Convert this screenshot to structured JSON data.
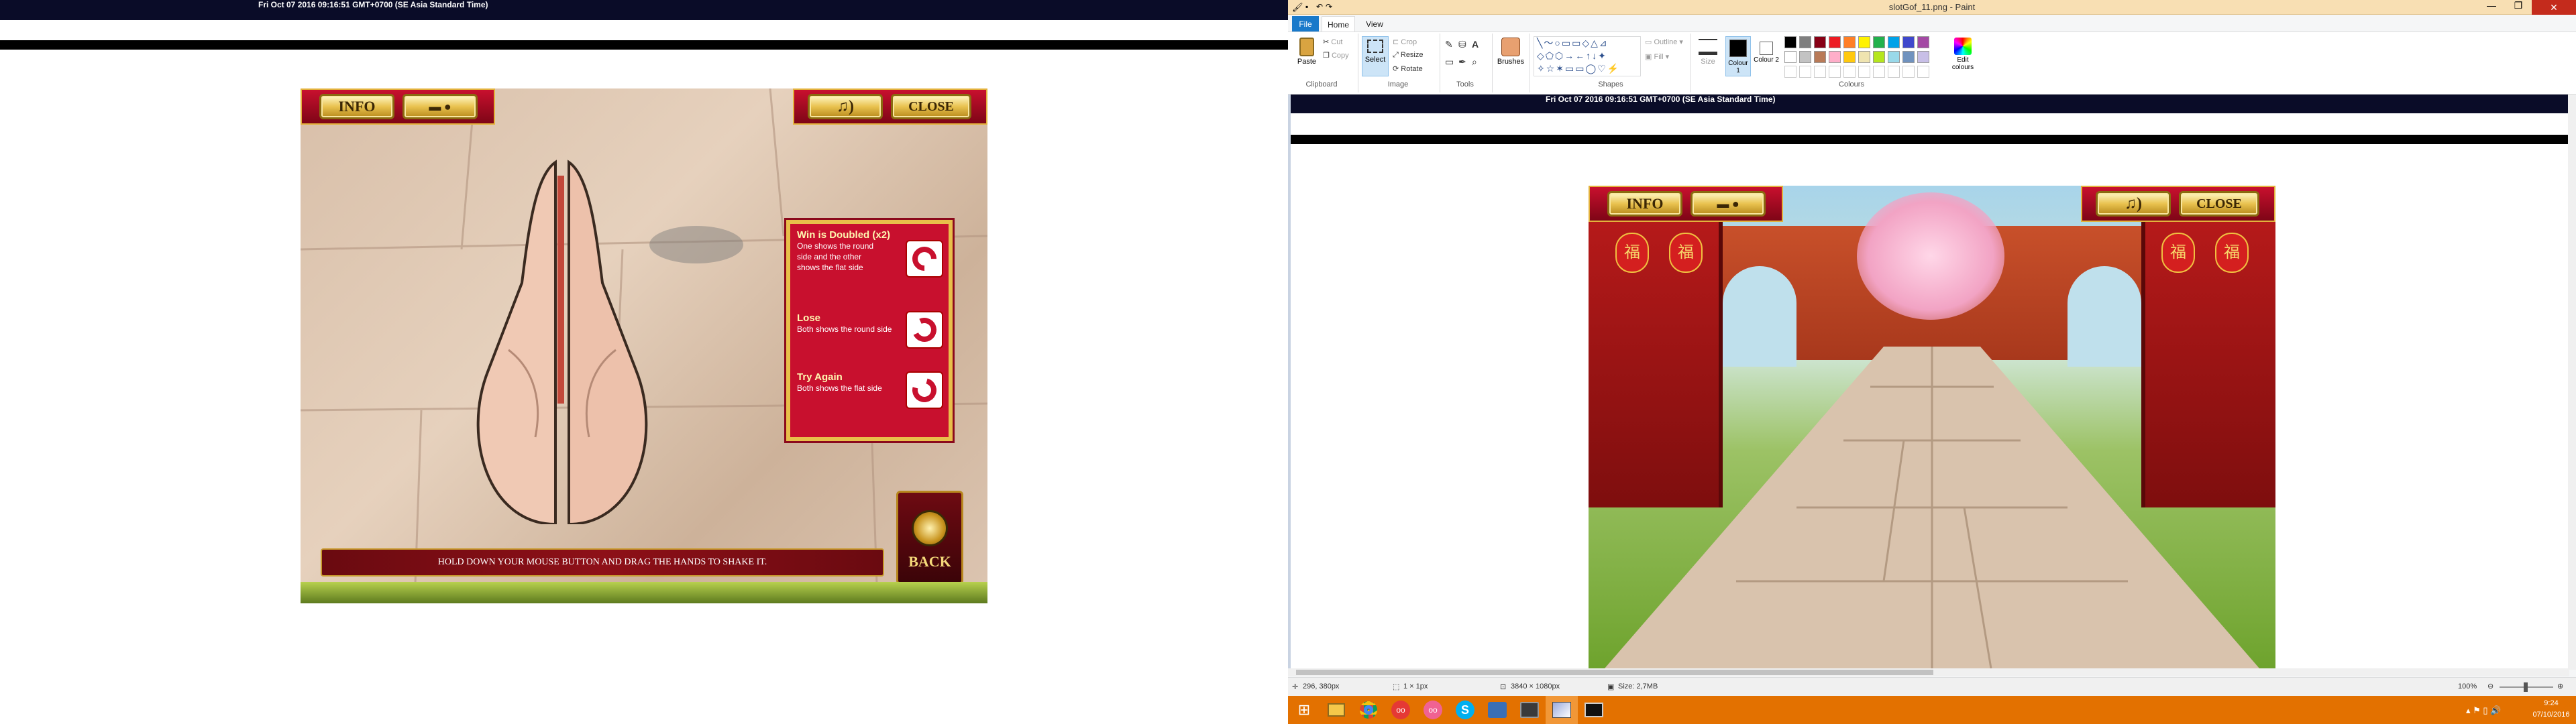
{
  "left_screen": {
    "timestamp": "Fri Oct 07 2016 09:16:51 GMT+0700 (SE Asia Standard Time)",
    "buttons": {
      "info": "INFO",
      "close": "CLOSE",
      "back": "BACK"
    },
    "panel": {
      "sections": [
        {
          "title": "Win is Doubled",
          "badge": "(x2)",
          "desc": "One shows the round side and the other shows the flat side"
        },
        {
          "title": "Lose",
          "badge": "",
          "desc": "Both shows the round side"
        },
        {
          "title": "Try Again",
          "badge": "",
          "desc": "Both shows the flat side"
        }
      ]
    },
    "hint": "HOLD DOWN YOUR MOUSE BUTTON AND DRAG THE HANDS TO SHAKE IT."
  },
  "paint": {
    "title": "slotGof_11.png - Paint",
    "tabs": [
      "File",
      "Home",
      "View"
    ],
    "clipboard": {
      "paste": "Paste",
      "cut": "Cut",
      "copy": "Copy",
      "label": "Clipboard"
    },
    "image": {
      "select": "Select",
      "crop": "Crop",
      "resize": "Resize",
      "rotate": "Rotate",
      "label": "Image"
    },
    "tools": {
      "label": "Tools"
    },
    "brushes": "Brushes",
    "shapes": {
      "outline": "Outline",
      "fill": "Fill",
      "label": "Shapes"
    },
    "size": "Size",
    "colour1": "Colour 1",
    "colour2": "Colour 2",
    "colours_label": "Colours",
    "edit_colours": "Edit colours",
    "palette": [
      "#000000",
      "#7f7f7f",
      "#880015",
      "#ed1c24",
      "#ff7f27",
      "#fff200",
      "#22b14c",
      "#00a2e8",
      "#3f48cc",
      "#a349a4",
      "#ffffff",
      "#c3c3c3",
      "#b97a57",
      "#ffaec9",
      "#ffc90e",
      "#efe4b0",
      "#b5e61d",
      "#99d9ea",
      "#7092be",
      "#c8bfe7"
    ],
    "canvas": {
      "timestamp": "Fri Oct 07 2016 09:16:51 GMT+0700 (SE Asia Standard Time)",
      "buttons": {
        "info": "INFO",
        "close": "CLOSE"
      },
      "sign": "福"
    },
    "status": {
      "cursor": "296, 380px",
      "selection": "1 × 1px",
      "dimensions": "3840 × 1080px",
      "size": "Size: 2,7MB",
      "zoom": "100%"
    }
  },
  "taskbar": {
    "time": "9:24",
    "date": "07/10/2016",
    "apps": [
      "start-icon",
      "file-explorer-icon",
      "chrome-icon",
      "app-red-icon",
      "app-red2-icon",
      "skype-icon",
      "app-blue-icon",
      "app-dark-icon",
      "paint-icon",
      "terminal-icon"
    ]
  }
}
